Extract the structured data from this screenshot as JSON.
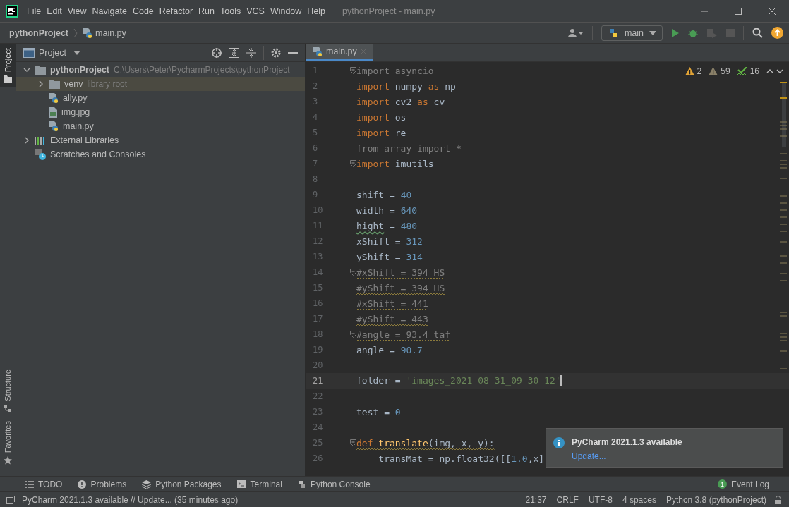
{
  "window": {
    "title": "pythonProject - main.py",
    "menu": [
      "File",
      "Edit",
      "View",
      "Navigate",
      "Code",
      "Refactor",
      "Run",
      "Tools",
      "VCS",
      "Window",
      "Help"
    ]
  },
  "navbar": {
    "breadcrumbs": [
      "pythonProject",
      "main.py"
    ],
    "run_config": "main"
  },
  "left_stripe": [
    {
      "label": "Project",
      "kind": "project",
      "selected": true
    },
    {
      "label": "Structure",
      "kind": "structure",
      "selected": false
    },
    {
      "label": "Favorites",
      "kind": "favorites",
      "selected": false
    }
  ],
  "project_panel": {
    "title": "Project",
    "tree": [
      {
        "label": "pythonProject",
        "hint": "C:\\Users\\Peter\\PycharmProjects\\pythonProject",
        "kind": "root",
        "expanded": true,
        "selected": false,
        "children": [
          {
            "label": "venv",
            "hint": "library root",
            "kind": "folder",
            "expanded": false,
            "selected": true
          },
          {
            "label": "ally.py",
            "kind": "python",
            "selected": false
          },
          {
            "label": "img.jpg",
            "kind": "image",
            "selected": false
          },
          {
            "label": "main.py",
            "kind": "python",
            "selected": false
          }
        ]
      },
      {
        "label": "External Libraries",
        "kind": "libraries",
        "expanded": false,
        "selected": false
      },
      {
        "label": "Scratches and Consoles",
        "kind": "scratches",
        "selected": false
      }
    ]
  },
  "editor": {
    "tabs": [
      {
        "label": "main.py",
        "selected": true
      }
    ],
    "inspections": [
      {
        "kind": "warning",
        "count": "2"
      },
      {
        "kind": "weak",
        "count": "59"
      },
      {
        "kind": "typo",
        "count": "16"
      }
    ],
    "lines": [
      {
        "number": "1",
        "fold": true,
        "current": false,
        "warning": false,
        "tokens": [
          {
            "kind": "unused",
            "text": "import asyncio"
          }
        ]
      },
      {
        "number": "2",
        "fold": false,
        "current": false,
        "warning": false,
        "tokens": [
          {
            "kind": "kw",
            "text": "import "
          },
          {
            "kind": "name",
            "text": "numpy "
          },
          {
            "kind": "kw",
            "text": "as "
          },
          {
            "kind": "name",
            "text": "np"
          }
        ]
      },
      {
        "number": "3",
        "fold": false,
        "current": false,
        "warning": false,
        "tokens": [
          {
            "kind": "kw",
            "text": "import "
          },
          {
            "kind": "name",
            "text": "cv2 "
          },
          {
            "kind": "kw",
            "text": "as "
          },
          {
            "kind": "name",
            "text": "cv"
          }
        ]
      },
      {
        "number": "4",
        "fold": false,
        "current": false,
        "warning": false,
        "tokens": [
          {
            "kind": "kw",
            "text": "import "
          },
          {
            "kind": "name",
            "text": "os"
          }
        ]
      },
      {
        "number": "5",
        "fold": false,
        "current": false,
        "warning": false,
        "tokens": [
          {
            "kind": "kw",
            "text": "import "
          },
          {
            "kind": "name",
            "text": "re"
          }
        ]
      },
      {
        "number": "6",
        "fold": false,
        "current": false,
        "warning": false,
        "tokens": [
          {
            "kind": "unused",
            "text": "from array import *"
          }
        ]
      },
      {
        "number": "7",
        "fold": true,
        "current": false,
        "warning": false,
        "tokens": [
          {
            "kind": "kw",
            "text": "import "
          },
          {
            "kind": "name",
            "text": "imutils"
          }
        ]
      },
      {
        "number": "8",
        "fold": false,
        "current": false,
        "warning": false
      },
      {
        "number": "9",
        "fold": false,
        "current": false,
        "warning": false,
        "tokens": [
          {
            "kind": "name",
            "text": "shift = "
          },
          {
            "kind": "num",
            "text": "40"
          }
        ]
      },
      {
        "number": "10",
        "fold": false,
        "current": false,
        "warning": false,
        "tokens": [
          {
            "kind": "name",
            "text": "width = "
          },
          {
            "kind": "num",
            "text": "640"
          }
        ]
      },
      {
        "number": "11",
        "fold": false,
        "current": false,
        "warning": false,
        "tokens": [
          {
            "kind": "typo",
            "text": "hight"
          },
          {
            "kind": "name",
            "text": " = "
          },
          {
            "kind": "num",
            "text": "480"
          }
        ]
      },
      {
        "number": "12",
        "fold": false,
        "current": false,
        "warning": false,
        "tokens": [
          {
            "kind": "name",
            "text": "xShift = "
          },
          {
            "kind": "num",
            "text": "312"
          }
        ]
      },
      {
        "number": "13",
        "fold": false,
        "current": false,
        "warning": false,
        "tokens": [
          {
            "kind": "name",
            "text": "yShift = "
          },
          {
            "kind": "num",
            "text": "314"
          }
        ]
      },
      {
        "number": "14",
        "fold": true,
        "current": false,
        "warning": true,
        "tokens": [
          {
            "kind": "comment",
            "text": "#xShift = 394 HS"
          }
        ]
      },
      {
        "number": "15",
        "fold": false,
        "current": false,
        "warning": true,
        "tokens": [
          {
            "kind": "comment",
            "text": "#yShift = 394 HS"
          }
        ]
      },
      {
        "number": "16",
        "fold": false,
        "current": false,
        "warning": true,
        "tokens": [
          {
            "kind": "comment",
            "text": "#xShift = 441"
          }
        ]
      },
      {
        "number": "17",
        "fold": false,
        "current": false,
        "warning": true,
        "tokens": [
          {
            "kind": "comment",
            "text": "#yShift = 443"
          }
        ]
      },
      {
        "number": "18",
        "fold": true,
        "current": false,
        "warning": true,
        "tokens": [
          {
            "kind": "comment",
            "text": "#angle = 93.4 taf"
          }
        ]
      },
      {
        "number": "19",
        "fold": false,
        "current": false,
        "warning": false,
        "tokens": [
          {
            "kind": "name",
            "text": "angle = "
          },
          {
            "kind": "num",
            "text": "90.7"
          }
        ]
      },
      {
        "number": "20",
        "fold": false,
        "current": false,
        "warning": false
      },
      {
        "number": "21",
        "fold": false,
        "current": true,
        "warning": false,
        "tokens": [
          {
            "kind": "name",
            "text": "folder = "
          },
          {
            "kind": "str",
            "text": "'images_2021-08-31_09-30-12'"
          }
        ]
      },
      {
        "number": "22",
        "fold": false,
        "current": false,
        "warning": false
      },
      {
        "number": "23",
        "fold": false,
        "current": false,
        "warning": false,
        "tokens": [
          {
            "kind": "name",
            "text": "test = "
          },
          {
            "kind": "num",
            "text": "0"
          }
        ]
      },
      {
        "number": "24",
        "fold": false,
        "current": false,
        "warning": false
      },
      {
        "number": "25",
        "fold": true,
        "current": false,
        "warning": true,
        "tokens": [
          {
            "kind": "kw",
            "text": "def "
          },
          {
            "kind": "func",
            "text": "translate"
          },
          {
            "kind": "name",
            "text": "(img, x, y):"
          }
        ]
      },
      {
        "number": "26",
        "fold": false,
        "current": false,
        "warning": false,
        "tokens": [
          {
            "kind": "name",
            "text": "    transMat = np.float32([["
          },
          {
            "kind": "num",
            "text": "1.0"
          },
          {
            "kind": "name",
            "text": ",x]"
          }
        ]
      }
    ]
  },
  "notification": {
    "title": "PyCharm 2021.1.3 available",
    "link": "Update..."
  },
  "tool_windows": [
    {
      "label": "TODO",
      "kind": "todo"
    },
    {
      "label": "Problems",
      "kind": "problems"
    },
    {
      "label": "Python Packages",
      "kind": "packages"
    },
    {
      "label": "Terminal",
      "kind": "terminal"
    },
    {
      "label": "Python Console",
      "kind": "console"
    }
  ],
  "event_log": {
    "label": "Event Log",
    "badge": "1"
  },
  "status_bar": {
    "message": "PyCharm 2021.1.3 available // Update... (35 minutes ago)",
    "items": [
      "21:37",
      "CRLF",
      "UTF-8",
      "4 spaces",
      "Python 3.8 (pythonProject)"
    ]
  }
}
